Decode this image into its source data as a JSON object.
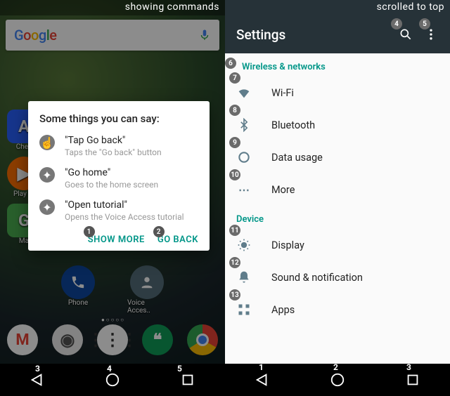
{
  "left": {
    "status_text": "showing commands",
    "search_logo": "Google",
    "home_apps": [
      {
        "label": "Chec",
        "color": "#2962FF",
        "letter": "A"
      },
      {
        "label": "Play M",
        "color": "#FF6F00",
        "shape": "play"
      },
      {
        "label": "Ma",
        "color": "#4CAF50",
        "letter": "G"
      }
    ],
    "fav_apps": [
      {
        "label": "Phone",
        "color": "#0D47A1",
        "key": "phone"
      },
      {
        "label": "Voice Acces..",
        "color": "#546E7A",
        "key": "voice"
      }
    ],
    "dock_apps": [
      "gmail",
      "camera",
      "drawer",
      "hangouts",
      "chrome"
    ],
    "card": {
      "title": "Some things you can say:",
      "items": [
        {
          "icon": "tap",
          "title": "\"Tap Go back\"",
          "sub": "Taps the \"Go back\" button"
        },
        {
          "icon": "compass",
          "title": "\"Go home\"",
          "sub": "Goes to the home screen"
        },
        {
          "icon": "compass",
          "title": "\"Open tutorial\"",
          "sub": "Opens the Voice Access tutorial"
        }
      ],
      "buttons": [
        {
          "label": "SHOW MORE",
          "num": "1"
        },
        {
          "label": "GO BACK",
          "num": "2"
        }
      ]
    },
    "nav_tags": [
      "3",
      "4",
      "5"
    ]
  },
  "right": {
    "status_text": "scrolled to top",
    "appbar": {
      "title": "Settings",
      "search_num": "4",
      "menu_num": "5"
    },
    "section1": {
      "title": "Wireless & networks",
      "num": "6"
    },
    "rows1": [
      {
        "icon": "wifi",
        "label": "Wi-Fi",
        "num": "7"
      },
      {
        "icon": "bt",
        "label": "Bluetooth",
        "num": "8"
      },
      {
        "icon": "data",
        "label": "Data usage",
        "num": "9"
      },
      {
        "icon": "more",
        "label": "More",
        "num": "10"
      }
    ],
    "section2": {
      "title": "Device"
    },
    "rows2": [
      {
        "icon": "display",
        "label": "Display",
        "num": "11"
      },
      {
        "icon": "sound",
        "label": "Sound & notification",
        "num": "12"
      },
      {
        "icon": "apps",
        "label": "Apps",
        "num": "13"
      }
    ],
    "nav_tags": [
      "1",
      "2",
      "3"
    ]
  }
}
